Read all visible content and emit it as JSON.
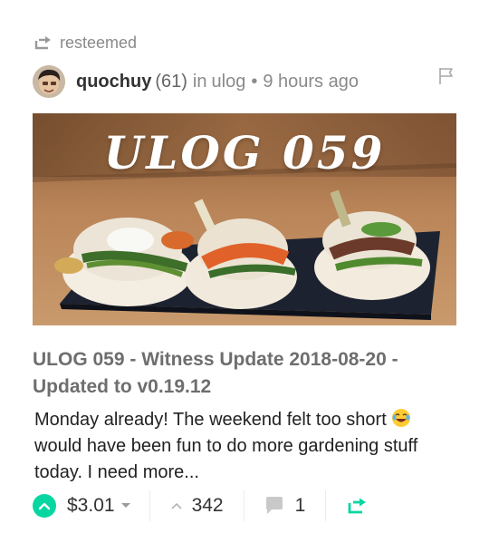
{
  "resteem": {
    "label": "resteemed",
    "icon": "reblog-icon"
  },
  "author": {
    "name": "quochuy",
    "reputation": "(61)",
    "in_word": "in",
    "community": "ulog",
    "separator": "•",
    "time": "9 hours ago",
    "avatar_icon": "avatar",
    "flag_icon": "flag-icon"
  },
  "thumbnail": {
    "overlay_text": "ULOG 059"
  },
  "post": {
    "title": "ULOG 059 - Witness Update 2018-08-20 - Updated to v0.19.12",
    "excerpt_part1": "Monday already! The weekend felt too short ",
    "excerpt_emoji": "laughing-face-emoji",
    "excerpt_part2": " would have been fun to do more gardening stuff today. I need more..."
  },
  "footer": {
    "payout": "$3.01",
    "votes": "342",
    "comments": "1",
    "icons": [
      "upvote-icon",
      "chevron-down-icon",
      "votes-icon",
      "comment-icon",
      "reblog-icon"
    ]
  },
  "colors": {
    "accent": "#07d6a0",
    "muted": "#8a8a8a",
    "title": "#6e6e6e",
    "text": "#222222"
  }
}
